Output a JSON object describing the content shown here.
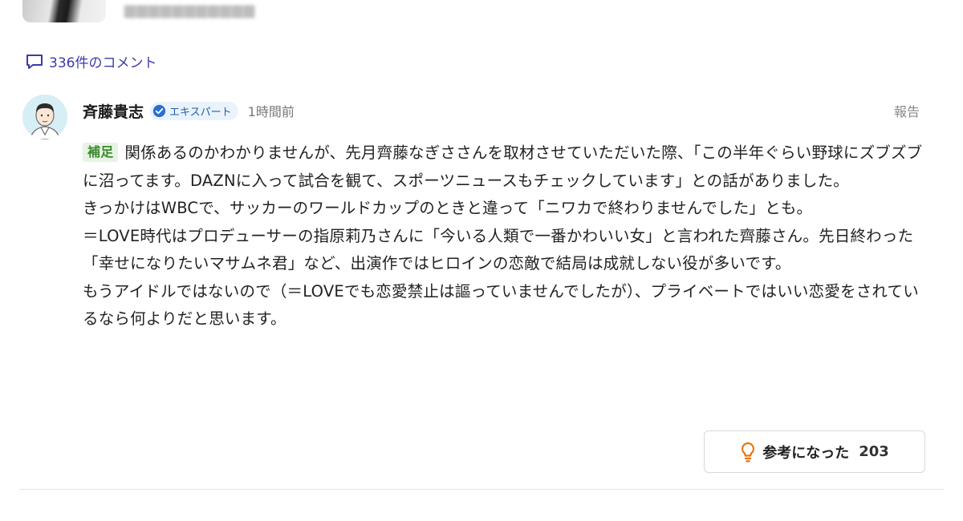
{
  "comments_header": {
    "count_label": "336件のコメント"
  },
  "comment": {
    "author": "斉藤貴志",
    "badge": "エキスパート",
    "time": "1時間前",
    "report": "報告",
    "tag": "補足",
    "paragraphs": [
      "関係あるのかわかりませんが、先月齊藤なぎささんを取材させていただいた際、「この半年ぐらい野球にズブズブに沼ってます。DAZNに入って試合を観て、スポーツニュースもチェックしています」との話がありました。",
      "きっかけはWBCで、サッカーのワールドカップのときと違って「ニワカで終わりませんでした」とも。",
      "＝LOVE時代はプロデューサーの指原莉乃さんに「今いる人類で一番かわいい女」と言われた齊藤さん。先日終わった「幸せになりたいマサムネ君」など、出演作ではヒロインの恋敵で結局は成就しない役が多いです。",
      "もうアイドルではないので（＝LOVEでも恋愛禁止は謳っていませんでしたが）、プライベートではいい恋愛をされているなら何よりだと思います。"
    ],
    "helpful_label": "参考になった",
    "helpful_count": "203"
  },
  "icons": {
    "comment": "speech-bubble-icon",
    "verified": "verified-check-icon",
    "helpful": "lightbulb-icon"
  },
  "colors": {
    "link": "#3d3aa8",
    "badge_text": "#1f5fa5",
    "badge_bg": "#eaf3fb",
    "tag_text": "#3a8a2e",
    "tag_bg": "#e6f4e3",
    "bulb": "#e8730c"
  }
}
